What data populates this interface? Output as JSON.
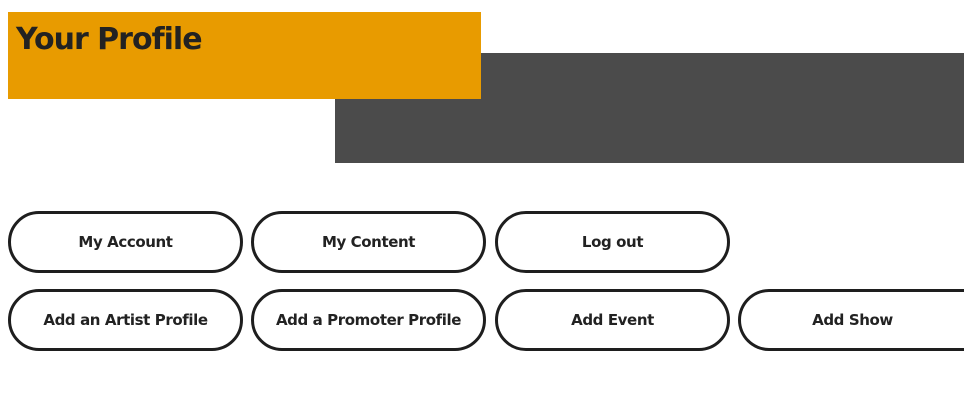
{
  "header": {
    "title": "Your Profile"
  },
  "colors": {
    "accent": "#e89b00",
    "dark_banner": "#4b4b4b",
    "text": "#222222",
    "button_border": "#1e1e1e"
  },
  "account_actions": {
    "my_account": "My Account",
    "my_content": "My Content",
    "log_out": "Log out"
  },
  "add_actions": {
    "add_artist_profile": "Add an Artist Profile",
    "add_promoter_profile": "Add a Promoter Profile",
    "add_event": "Add Event",
    "add_show": "Add Show"
  }
}
